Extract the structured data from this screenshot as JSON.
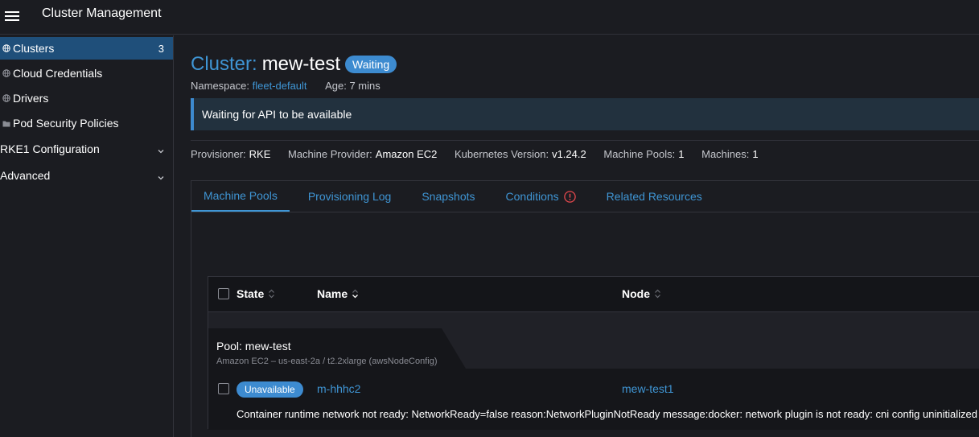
{
  "header": {
    "title": "Cluster Management"
  },
  "sidebar": {
    "items": [
      {
        "label": "Clusters",
        "count": "3",
        "icon": "globe-icon"
      },
      {
        "label": "Cloud Credentials",
        "icon": "globe-icon"
      },
      {
        "label": "Drivers",
        "icon": "globe-icon"
      },
      {
        "label": "Pod Security Policies",
        "icon": "folder-icon"
      }
    ],
    "groups": [
      {
        "label": "RKE1 Configuration"
      },
      {
        "label": "Advanced"
      }
    ]
  },
  "page": {
    "title_prefix": "Cluster:",
    "title_name": "mew-test",
    "status": "Waiting",
    "namespace_label": "Namespace:",
    "namespace_value": "fleet-default",
    "age_label": "Age:",
    "age_value": "7 mins",
    "banner": "Waiting for API to be available"
  },
  "info": {
    "provisioner_label": "Provisioner:",
    "provisioner_value": "RKE",
    "machine_provider_label": "Machine Provider:",
    "machine_provider_value": "Amazon EC2",
    "k8s_version_label": "Kubernetes Version:",
    "k8s_version_value": "v1.24.2",
    "machine_pools_label": "Machine Pools:",
    "machine_pools_value": "1",
    "machines_label": "Machines:",
    "machines_value": "1"
  },
  "tabs": [
    {
      "label": "Machine Pools"
    },
    {
      "label": "Provisioning Log"
    },
    {
      "label": "Snapshots"
    },
    {
      "label": "Conditions"
    },
    {
      "label": "Related Resources"
    }
  ],
  "table": {
    "columns": [
      "State",
      "Name",
      "Node"
    ],
    "group": {
      "title": "Pool: mew-test",
      "subtitle": "Amazon EC2 – us-east-2a / t2.2xlarge (awsNodeConfig)"
    },
    "rows": [
      {
        "state": "Unavailable",
        "name": "m-hhhc2",
        "node": "mew-test1",
        "message": "Container runtime network not ready: NetworkReady=false reason:NetworkPluginNotReady message:docker: network plugin is not ready: cni config uninitialized"
      }
    ]
  },
  "colors": {
    "accent": "#3f95d4",
    "active_sidebar": "#1f4f7a",
    "background": "#1b1c21",
    "error": "#e5484d"
  }
}
